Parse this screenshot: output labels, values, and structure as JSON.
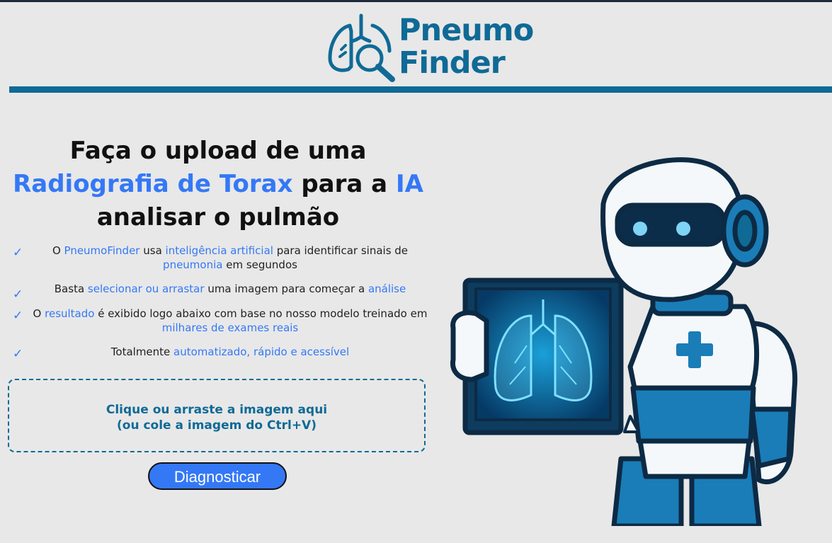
{
  "brand": {
    "line1": "Pneumo",
    "line2": "Finder",
    "logo_icon": "lungs-magnifier-icon",
    "color": "#0f6a96"
  },
  "hero": {
    "line1": "Faça o upload de uma",
    "line2_highlight": "Radiografia de Torax",
    "line2_plain": " para a ",
    "line2_ia": "IA",
    "line3": "analisar o pulmão",
    "highlight_color": "#3478f6"
  },
  "features": [
    {
      "icon": "check-icon",
      "parts": [
        "O ",
        "PneumoFinder",
        " usa ",
        "inteligência artificial",
        " para identificar sinais de ",
        "pneumonia",
        " em segundos"
      ]
    },
    {
      "icon": "check-icon",
      "parts": [
        "Basta ",
        "selecionar ou arrastar",
        " uma imagem para começar a ",
        "análise"
      ]
    },
    {
      "icon": "check-icon",
      "parts": [
        "O ",
        "resultado",
        " é exibido logo abaixo com base no nosso modelo treinado em ",
        "milhares de exames reais"
      ]
    },
    {
      "icon": "check-icon",
      "parts": [
        "Totalmente ",
        "automatizado, rápido e acessível"
      ]
    }
  ],
  "check_mark": "✓",
  "dropzone": {
    "line1": "Clique ou arraste a imagem aqui",
    "line2": "(ou cole a imagem do Ctrl+V)"
  },
  "diagnose_button": "Diagnosticar",
  "illustration": "robot-holding-xray-illustration"
}
